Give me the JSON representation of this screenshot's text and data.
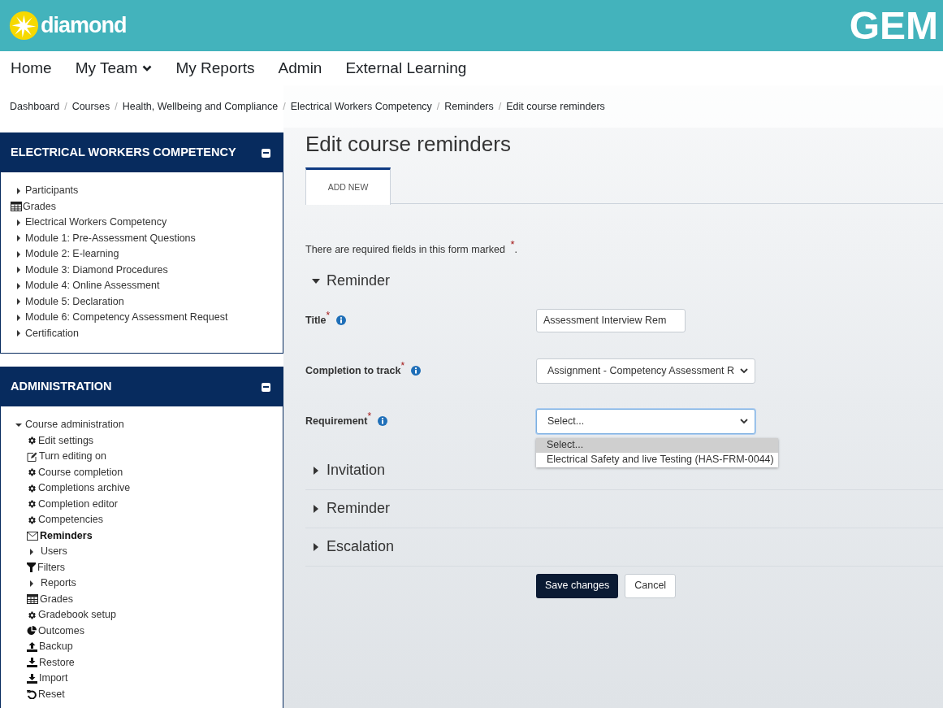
{
  "header": {
    "logo_text": "diamond",
    "brand": "GEM"
  },
  "nav": [
    {
      "label": "Home",
      "kind": "link"
    },
    {
      "label": "My Team",
      "kind": "dropdown"
    },
    {
      "label": "My Reports",
      "kind": "link"
    },
    {
      "label": "Admin",
      "kind": "link"
    },
    {
      "label": "External Learning",
      "kind": "link"
    }
  ],
  "breadcrumb_separator": "/",
  "breadcrumb": [
    "Dashboard",
    "Courses",
    "Health, Wellbeing and Compliance",
    "Electrical Workers Competency",
    "Reminders",
    "Edit course reminders"
  ],
  "course_block": {
    "title": "ELECTRICAL WORKERS COMPETENCY",
    "items": [
      {
        "label": "Participants",
        "kind": "caret"
      },
      {
        "label": "Grades",
        "kind": "table"
      },
      {
        "label": "Electrical Workers Competency",
        "kind": "caret"
      },
      {
        "label": "Module 1: Pre-Assessment Questions",
        "kind": "caret"
      },
      {
        "label": "Module 2: E-learning",
        "kind": "caret"
      },
      {
        "label": "Module 3: Diamond Procedures",
        "kind": "caret"
      },
      {
        "label": "Module 4: Online Assessment",
        "kind": "caret"
      },
      {
        "label": "Module 5: Declaration",
        "kind": "caret"
      },
      {
        "label": "Module 6: Competency Assessment Request",
        "kind": "caret"
      },
      {
        "label": "Certification",
        "kind": "caret"
      }
    ]
  },
  "admin_block": {
    "title": "ADMINISTRATION",
    "items": [
      {
        "label": "Course administration",
        "expanded": true,
        "children": [
          {
            "label": "Edit settings",
            "kind": "gear",
            "current": false
          },
          {
            "label": "Turn editing on",
            "kind": "edit",
            "current": false
          },
          {
            "label": "Course completion",
            "kind": "gear",
            "current": false
          },
          {
            "label": "Completions archive",
            "kind": "gear",
            "current": false
          },
          {
            "label": "Completion editor",
            "kind": "gear",
            "current": false
          },
          {
            "label": "Competencies",
            "kind": "gear",
            "current": false
          },
          {
            "label": "Reminders",
            "kind": "envelope",
            "current": true
          },
          {
            "label": "Users",
            "kind": "caret",
            "current": false
          },
          {
            "label": "Filters",
            "kind": "filter",
            "current": false
          },
          {
            "label": "Reports",
            "kind": "caret",
            "current": false
          },
          {
            "label": "Grades",
            "kind": "table",
            "current": false
          },
          {
            "label": "Gradebook setup",
            "kind": "gear",
            "current": false
          },
          {
            "label": "Outcomes",
            "kind": "pie",
            "current": false
          },
          {
            "label": "Backup",
            "kind": "upload",
            "current": false
          },
          {
            "label": "Restore",
            "kind": "download",
            "current": false
          },
          {
            "label": "Import",
            "kind": "download",
            "current": false
          },
          {
            "label": "Reset",
            "kind": "undo",
            "current": false
          }
        ]
      }
    ]
  },
  "form": {
    "heading": "Edit course reminders",
    "tabs": [
      {
        "label": "ADD NEW",
        "selected": true
      }
    ],
    "required_note": "There are required fields in this form marked $^{*}$.",
    "required_mark": "*",
    "sections": [
      {
        "title": "Reminder",
        "expanded": true,
        "fields": [
          {
            "label": "Title",
            "kind": "text",
            "value": "Assessment Interview Rem",
            "required": true
          },
          {
            "label": "Completion to track",
            "kind": "select",
            "value": "Assignment - Competency Assessment R",
            "required": true
          },
          {
            "label": "Requirement",
            "kind": "select",
            "value": "Select...",
            "required": true,
            "open": true,
            "options": [
              {
                "label": "Select...",
                "selected": true
              },
              {
                "label": "Electrical Safety and live Testing (HAS-FRM-0044)",
                "selected": false
              }
            ]
          }
        ]
      },
      {
        "title": "Invitation",
        "expanded": false
      },
      {
        "title": "Reminder",
        "expanded": false
      },
      {
        "title": "Escalation",
        "expanded": false
      }
    ],
    "buttons": [
      {
        "label": "Save changes",
        "kind": "primary"
      },
      {
        "label": "Cancel",
        "kind": "secondary"
      }
    ]
  }
}
